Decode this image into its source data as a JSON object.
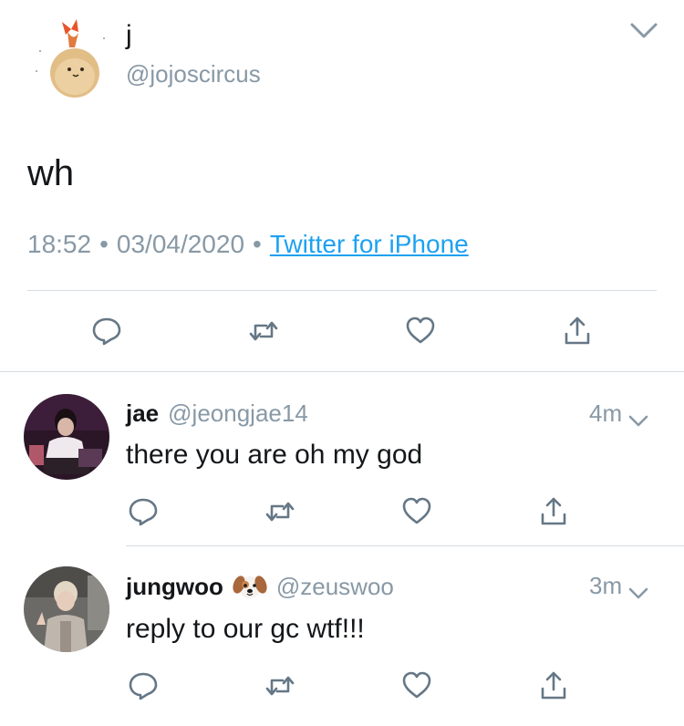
{
  "main_tweet": {
    "display_name": "j",
    "handle": "@jojoscircus",
    "text": "wh",
    "time": "18:52",
    "date": "03/04/2020",
    "source": "Twitter for iPhone",
    "separator": "•"
  },
  "replies": [
    {
      "display_name": "jae",
      "handle": "@jeongjae14",
      "time": "4m",
      "text": "there you are oh my god"
    },
    {
      "display_name": "jungwoo",
      "emoji": "puppy-face-emoji",
      "handle": "@zeuswoo",
      "time": "3m",
      "text": "reply to our gc wtf!!!"
    }
  ],
  "icons": {
    "reply": "reply-icon",
    "retweet": "retweet-icon",
    "like": "heart-icon",
    "share": "share-icon",
    "menu": "chevron-down-icon"
  },
  "colors": {
    "link": "#1da1f2",
    "secondary_text": "#8899a6",
    "icon": "#657786",
    "divider": "#d6dbdf"
  }
}
